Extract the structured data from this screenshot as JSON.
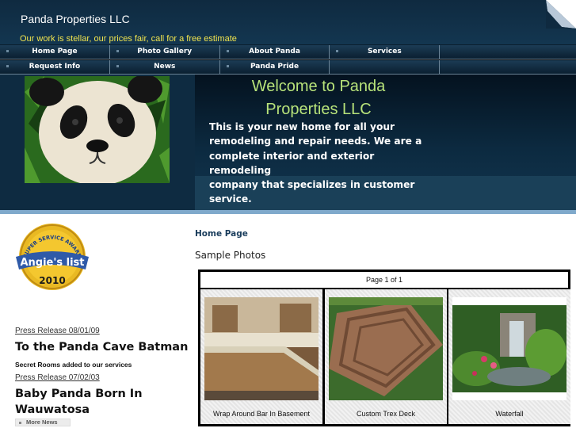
{
  "header": {
    "site_title": "Panda Properties LLC",
    "tagline": "Our work is stellar, our prices fair, call for a free estimate"
  },
  "nav": {
    "row1": [
      "Home Page",
      "Photo Gallery",
      "About Panda",
      "Services"
    ],
    "row2": [
      "Request Info",
      "News",
      "Panda Pride"
    ]
  },
  "hero": {
    "welcome_line1": "Welcome to Panda",
    "welcome_line2": "Properties LLC",
    "intro_lines": [
      "This is your new home for all your",
      "remodeling and repair needs.  We are a",
      "complete interior and exterior remodeling",
      "company that specializes in customer",
      "service."
    ]
  },
  "badge": {
    "arc_text": "SUPER SERVICE AWARD",
    "brand": "Angie's list",
    "year": "2010"
  },
  "news": {
    "items": [
      {
        "link": "Press Release 08/01/09",
        "headline": "To the Panda Cave Batman",
        "blurb": "Secret Rooms added to our services"
      },
      {
        "link": "Press Release 07/02/03",
        "headline_line1": "Baby Panda Born In",
        "headline_line2": "Wauwatosa"
      }
    ],
    "more_label": "More News"
  },
  "main": {
    "breadcrumb": "Home Page",
    "section_title": "Sample Photos",
    "pager": "Page 1 of 1",
    "photos": [
      {
        "caption": "Wrap Around Bar In Basement"
      },
      {
        "caption": "Custom Trex Deck"
      },
      {
        "caption": "Waterfall"
      }
    ]
  },
  "colors": {
    "header_bg": "#0f2a40",
    "tagline": "#f1e44e",
    "welcome": "#b7e27a",
    "divider": "#7fa9cb",
    "breadcrumb": "#1a3d5c"
  }
}
